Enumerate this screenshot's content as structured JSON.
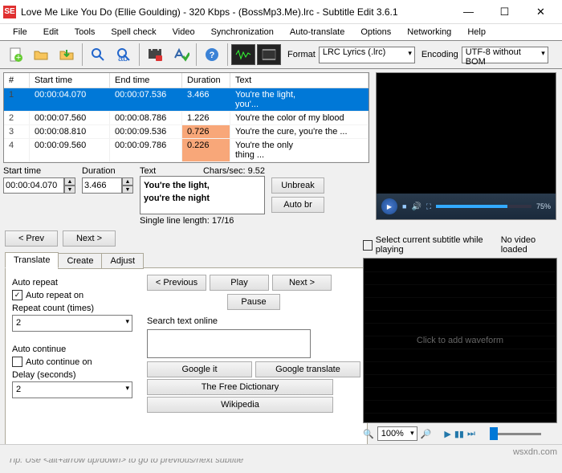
{
  "window": {
    "title": "Love Me Like You Do (Ellie Goulding) - 320 Kbps - (BossMp3.Me).lrc - Subtitle Edit 3.6.1",
    "icon_letter": "SE"
  },
  "menu": [
    "File",
    "Edit",
    "Tools",
    "Spell check",
    "Video",
    "Synchronization",
    "Auto-translate",
    "Options",
    "Networking",
    "Help"
  ],
  "toolbar": {
    "format_label": "Format",
    "format_value": "LRC Lyrics (.lrc)",
    "encoding_label": "Encoding",
    "encoding_value": "UTF-8 without BOM"
  },
  "columns": {
    "num": "#",
    "start": "Start time",
    "end": "End time",
    "dur": "Duration",
    "text": "Text"
  },
  "rows": [
    {
      "num": "1",
      "start": "00:00:04.070",
      "end": "00:00:07.536",
      "dur": "3.466",
      "text": "You're the light,<br />you'...",
      "sel": true
    },
    {
      "num": "2",
      "start": "00:00:07.560",
      "end": "00:00:08.786",
      "dur": "1.226",
      "text": "You're the color of my blood"
    },
    {
      "num": "3",
      "start": "00:00:08.810",
      "end": "00:00:09.536",
      "dur": "0.726",
      "text": "You're the cure, you're the ...",
      "warn": true
    },
    {
      "num": "4",
      "start": "00:00:09.560",
      "end": "00:00:09.786",
      "dur": "0.226",
      "text": "You're the only<br />thing ...",
      "warn": true
    }
  ],
  "edit": {
    "start_label": "Start time",
    "duration_label": "Duration",
    "start": "00:00:04.070",
    "duration": "3.466",
    "text_label": "Text",
    "chars_label": "Chars/sec: 9.52",
    "text_line1": "You're the light,",
    "text_line2": "you're the night",
    "single_line": "Single line length: 17/16",
    "unbreak": "Unbreak",
    "autobr": "Auto br",
    "prev": "< Prev",
    "next": "Next >"
  },
  "tabs": [
    "Translate",
    "Create",
    "Adjust"
  ],
  "translate": {
    "auto_repeat_label": "Auto repeat",
    "auto_repeat_on": "Auto repeat on",
    "repeat_count_label": "Repeat count (times)",
    "repeat_count": "2",
    "auto_continue_label": "Auto continue",
    "auto_continue_on": "Auto continue on",
    "delay_label": "Delay (seconds)",
    "delay": "2",
    "btn_prev": "< Previous",
    "btn_play": "Play",
    "btn_next": "Next >",
    "btn_pause": "Pause",
    "search_label": "Search text online",
    "google_it": "Google it",
    "google_tr": "Google translate",
    "free_dict": "The Free Dictionary",
    "wikipedia": "Wikipedia"
  },
  "tip": "Tip: Use <alt+arrow up/down> to go to previous/next subtitle",
  "right": {
    "select_current": "Select current subtitle while playing",
    "no_video": "No video loaded",
    "wave_hint": "Click to add waveform",
    "zoom": "100%",
    "progress": "75%"
  },
  "status": "wsxdn.com"
}
